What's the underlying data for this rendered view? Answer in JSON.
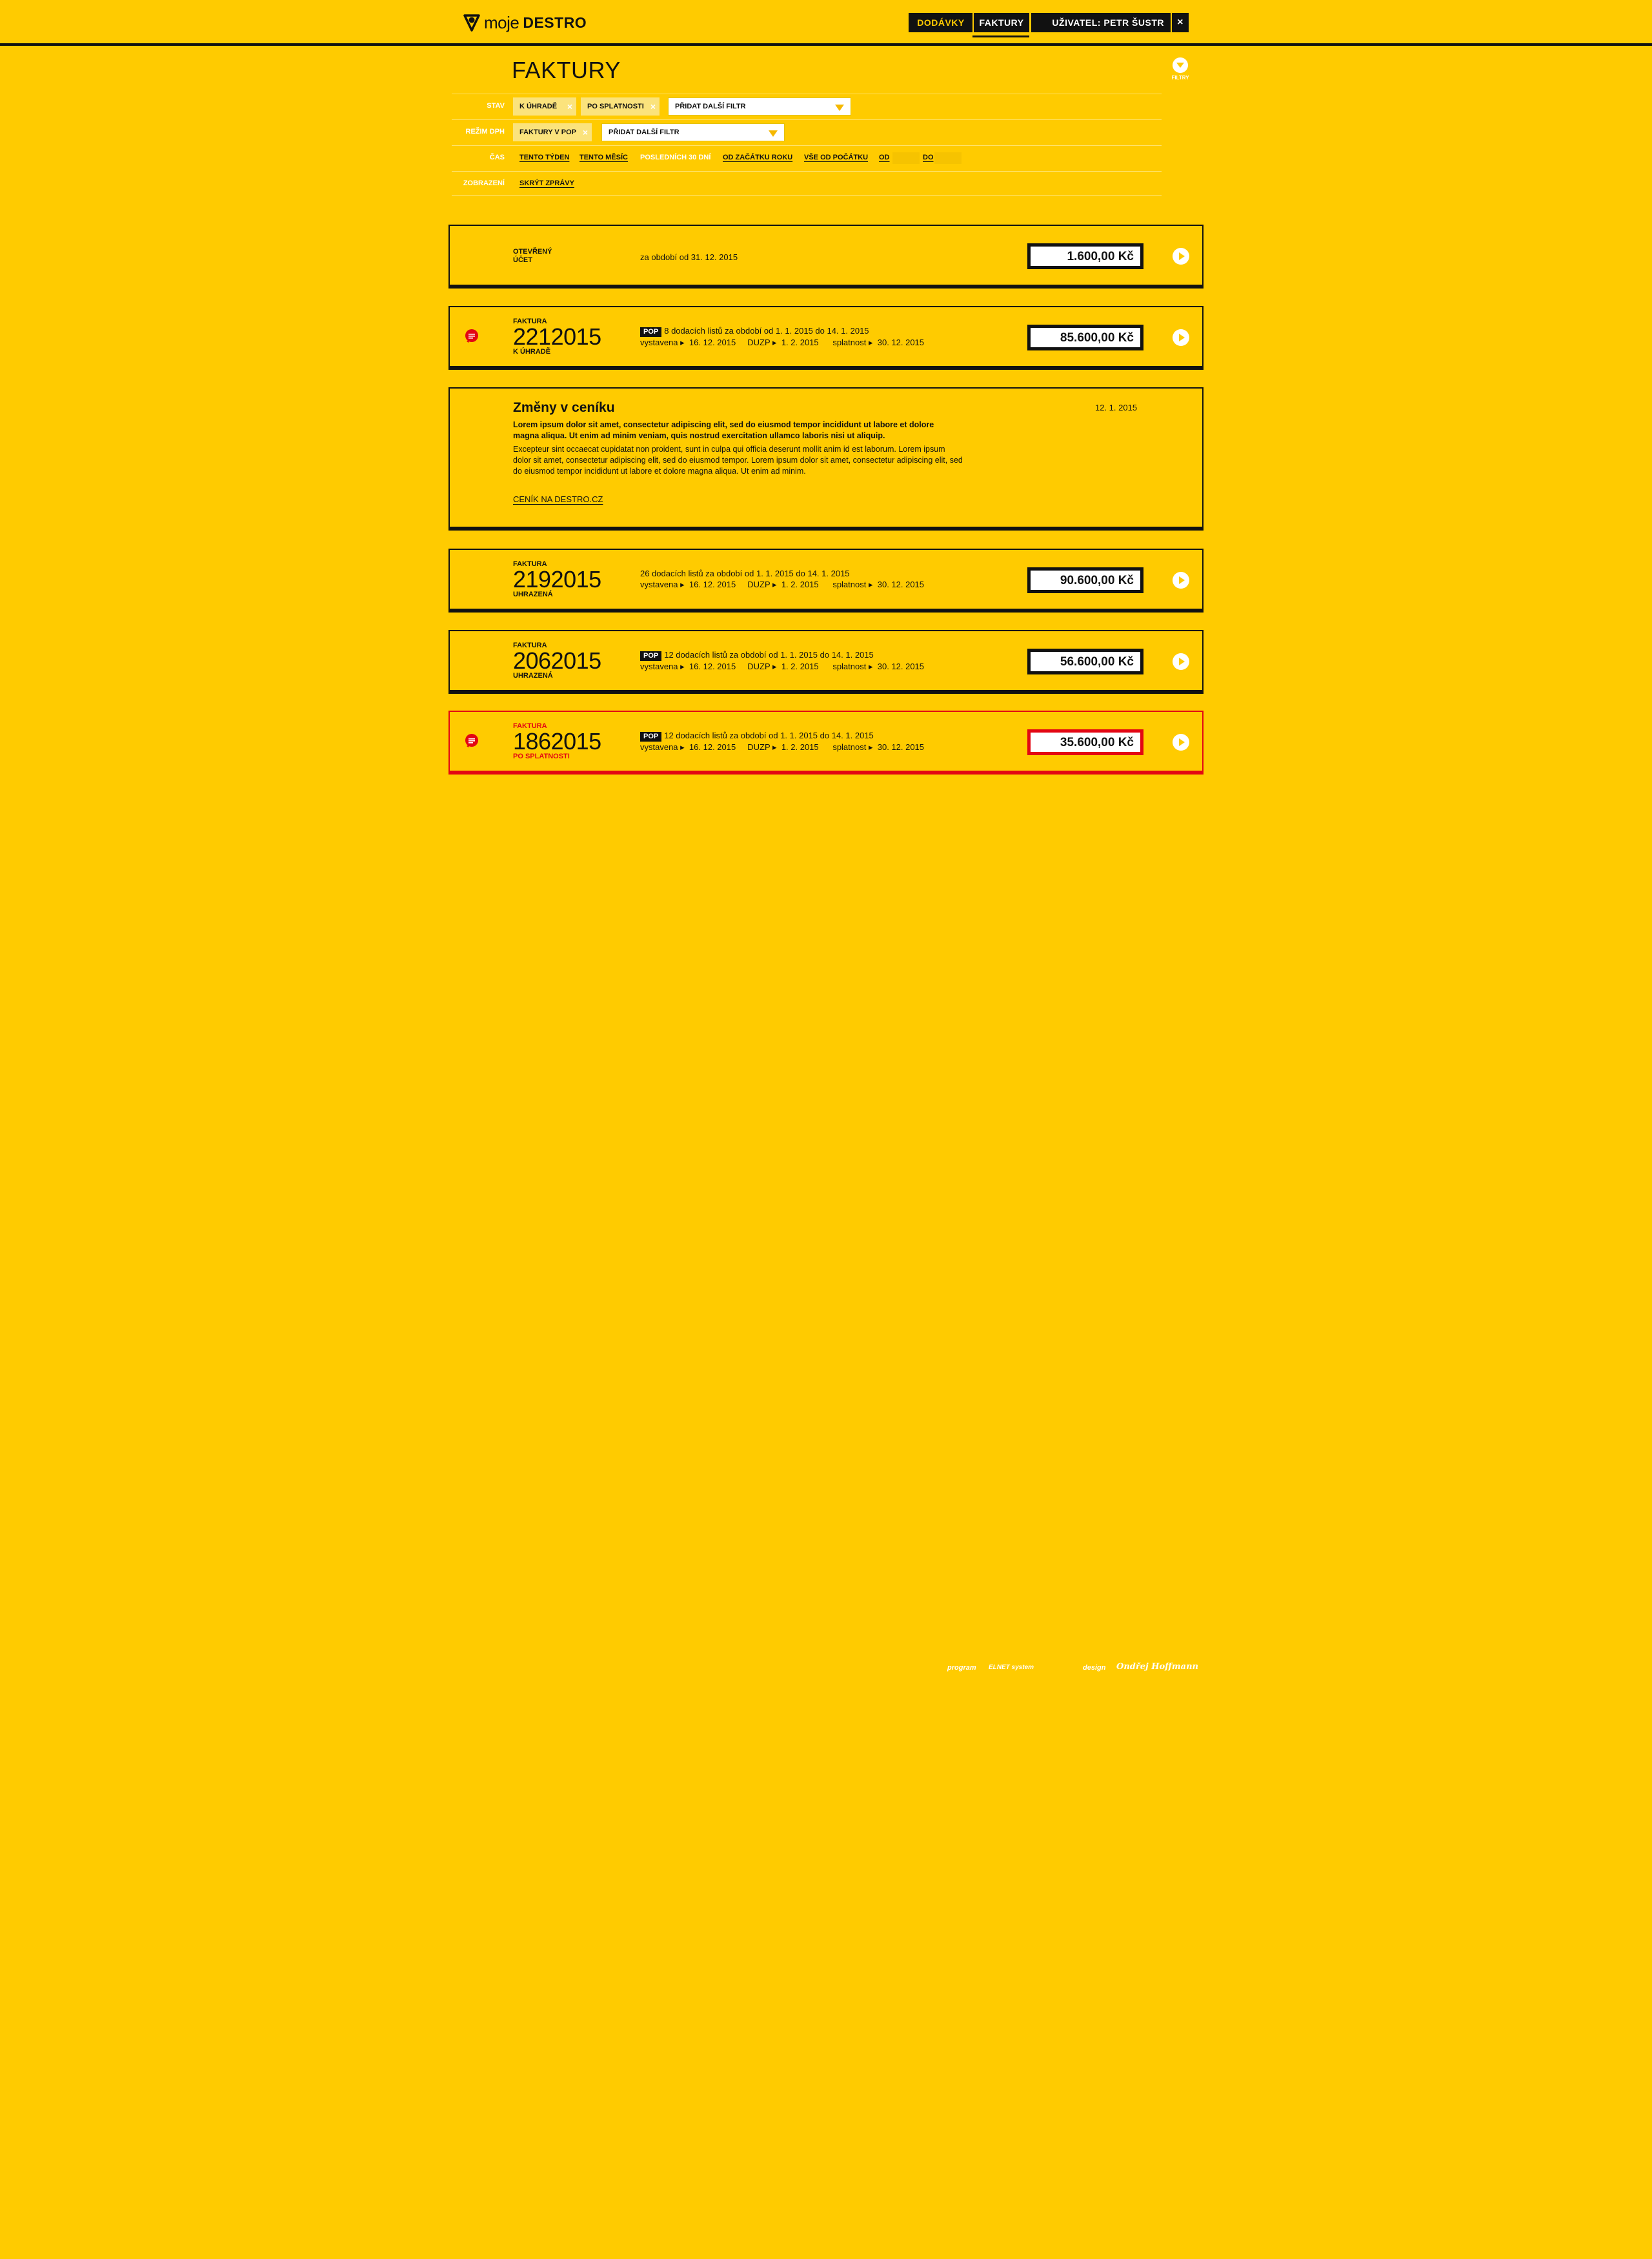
{
  "brand": {
    "logo_light": "moje",
    "logo_bold": "DESTRO"
  },
  "nav": {
    "deliveries": "DODÁVKY",
    "invoices": "FAKTURY",
    "user": "UŽIVATEL: PETR ŠUSTR",
    "close": "×"
  },
  "page": {
    "title": "FAKTURY",
    "filter_label": "FILTRY"
  },
  "filters": {
    "status_label": "STAV",
    "status_chips": [
      "K ÚHRADĚ",
      "PO SPLATNOSTI"
    ],
    "add_filter": "PŘIDAT DALŠÍ FILTR",
    "vat_label": "REŽIM DPH",
    "vat_chips": [
      "FAKTURY V POP"
    ],
    "time_label": "ČAS",
    "time_links": [
      "TENTO TÝDEN",
      "TENTO MĚSÍC",
      "POSLEDNÍCH 30 DNÍ",
      "OD ZAČÁTKU ROKU",
      "VŠE OD POČÁTKU"
    ],
    "from": "OD",
    "to": "DO",
    "display_label": "ZOBRAZENÍ",
    "hide_messages": "SKRÝT ZPRÁVY"
  },
  "open_account": {
    "label_line1": "OTEVŘENÝ",
    "label_line2": "ÚČET",
    "period": "za období od 31. 12. 2015",
    "amount": "1.600,00 Kč"
  },
  "labels": {
    "invoice": "FAKTURA",
    "issued": "vystavena",
    "duzp": "DUZP",
    "due": "splatnost",
    "pop": "POP"
  },
  "invoices": [
    {
      "number": "2212015",
      "state": "K ÚHRADĚ",
      "summary": "8 dodacích listů za období od 1. 1. 2015 do 14. 1. 2015",
      "pop": true,
      "issued": "16. 12. 2015",
      "duzp": "1. 2. 2015",
      "due": "30. 12. 2015",
      "amount": "85.600,00 Kč"
    },
    {
      "number": "2192015",
      "state": "UHRAZENÁ",
      "summary": "26 dodacích listů za období od 1. 1. 2015 do 14. 1. 2015",
      "pop": false,
      "issued": "16. 12. 2015",
      "duzp": "1. 2. 2015",
      "due": "30. 12. 2015",
      "amount": "90.600,00 Kč"
    },
    {
      "number": "2062015",
      "state": "UHRAZENÁ",
      "summary": "12 dodacích listů za období od 1. 1. 2015 do 14. 1. 2015",
      "pop": true,
      "issued": "16. 12. 2015",
      "duzp": "1. 2. 2015",
      "due": "30. 12. 2015",
      "amount": "56.600,00 Kč"
    },
    {
      "number": "1862015",
      "state": "PO SPLATNOSTI",
      "summary": "12 dodacích listů za období od 1. 1. 2015 do 14. 1. 2015",
      "pop": true,
      "issued": "16. 12. 2015",
      "duzp": "1. 2. 2015",
      "due": "30. 12. 2015",
      "amount": "35.600,00 Kč"
    }
  ],
  "news": {
    "title": "Změny v ceníku",
    "date": "12. 1. 2015",
    "bold_text": "Lorem ipsum dolor sit amet, consectetur adipiscing elit, sed do eiusmod tempor incididunt ut labore et dolore magna aliqua. Ut enim ad minim veniam, quis nostrud exercitation ullamco laboris nisi ut aliquip.",
    "text": "Excepteur sint occaecat cupidatat non proident, sunt in culpa qui officia deserunt mollit anim id est laborum. Lorem ipsum dolor sit amet, consectetur adipiscing elit, sed do eiusmod tempor. Lorem ipsum dolor sit amet, consectetur adipiscing elit, sed do eiusmod tempor incididunt ut labore et dolore magna aliqua. Ut enim ad minim.",
    "link": "CENÍK NA DESTRO.CZ"
  },
  "footer": {
    "program_label": "program",
    "program_brand": "ELNET system",
    "design_label": "design",
    "design_brand": "Ondřej Hoffmann"
  },
  "colors": {
    "background": "#ffcb00",
    "dark": "#111111",
    "alert": "#e30613"
  }
}
